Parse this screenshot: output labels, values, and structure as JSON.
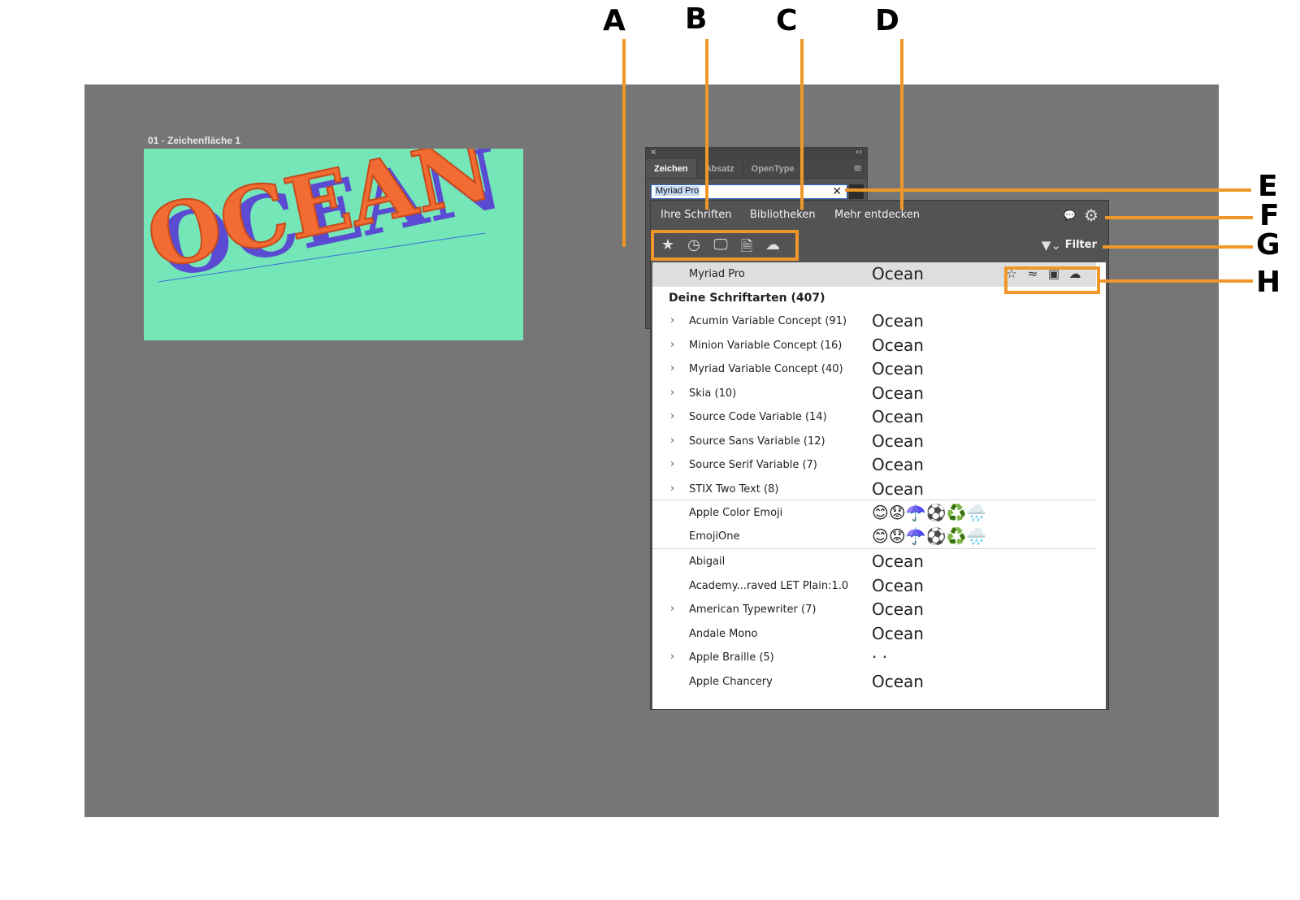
{
  "callouts": [
    "A",
    "B",
    "C",
    "D",
    "E",
    "F",
    "G",
    "H"
  ],
  "artboard": {
    "label": "01 - Zeichenfläche 1",
    "art_text": "OCEAN"
  },
  "char_panel": {
    "tabs": [
      "Zeichen",
      "Absatz",
      "OpenType"
    ],
    "font_input_value": "Myriad Pro",
    "close_glyph": "×",
    "collapse_glyph": "‹‹",
    "menu_glyph": "≡",
    "clear_glyph": "✕"
  },
  "font_popup": {
    "tabs": [
      "Ihre Schriften",
      "Bibliotheken",
      "Mehr entdecken"
    ],
    "filter_label": "Filter",
    "filter_icons": [
      "star-icon",
      "clock-icon",
      "monitor-icon",
      "document-icon",
      "cloud-icon"
    ],
    "selected_font": {
      "name": "Myriad Pro",
      "sample": "Ocean"
    },
    "section_header": "Deine Schriftarten (407)",
    "families": [
      {
        "name": "Acumin Variable Concept (91)",
        "sample": "Ocean",
        "expandable": true
      },
      {
        "name": "Minion Variable Concept (16)",
        "sample": "Ocean",
        "expandable": true
      },
      {
        "name": "Myriad Variable Concept (40)",
        "sample": "Ocean",
        "expandable": true
      },
      {
        "name": "Skia (10)",
        "sample": "Ocean",
        "expandable": true
      },
      {
        "name": "Source Code Variable (14)",
        "sample": "Ocean",
        "expandable": true
      },
      {
        "name": "Source Sans Variable (12)",
        "sample": "Ocean",
        "expandable": true
      },
      {
        "name": "Source Serif Variable (7)",
        "sample": "Ocean",
        "expandable": true
      },
      {
        "name": "STIX Two Text (8)",
        "sample": "Ocean",
        "expandable": true
      }
    ],
    "emoji_fonts": [
      {
        "name": "Apple Color Emoji",
        "sample": "😊😟☂️⚽♻️🌧️"
      },
      {
        "name": "EmojiOne",
        "sample": "😊😟☂️⚽♻️🌧️"
      }
    ],
    "other_fonts": [
      {
        "name": "Abigail",
        "sample": "Ocean",
        "expandable": false
      },
      {
        "name": "Academy...raved LET Plain:1.0",
        "sample": "Ocean",
        "expandable": false
      },
      {
        "name": "American Typewriter (7)",
        "sample": "Ocean",
        "expandable": true
      },
      {
        "name": "Andale Mono",
        "sample": "Ocean",
        "expandable": false
      },
      {
        "name": "Apple Braille (5)",
        "sample": "·  ·",
        "expandable": true
      },
      {
        "name": "Apple Chancery",
        "sample": "Ocean",
        "expandable": false
      }
    ]
  },
  "colors": {
    "accent_orange": "#f0972a",
    "workspace_gray": "#767676",
    "artboard_green": "#74e6b8",
    "letter_orange": "#f26b32",
    "letter_shadow": "#5a4bd2"
  }
}
